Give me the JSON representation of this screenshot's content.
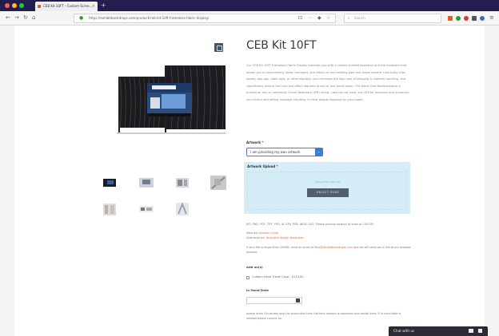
{
  "browser": {
    "tab_title": "CEB Kit 10FT - Custom Scree...",
    "tab_close": "×",
    "new_tab": "+",
    "url": "https://exhibitbackdrops.com/product/ceb-kit-10ft-frameless-fabric-display/",
    "search_placeholder": "Search"
  },
  "product": {
    "title": "CEB Kit 10FT",
    "description": "Our CEB Kit 10FT Frameless Fabric Display provides you with a custom printed backdrop and the hardware that allows you to conveniently store, transport, and attach to any existing pipe and drape system. Less bulky than easels, pop-ups, table tops, or other displays, you eliminate the high cost of shipping & material handling, and significantly reduce the time and effort required to set up and break down. The fabric that Backpackdrop is printed on has an Inherently Flame Retardant (IFR) rating. Last but not least, our CEB kit improves and enhances your brand and selling message resulting in more people stopping by your booth."
  },
  "form": {
    "artwork_label": "Artwork",
    "required_mark": "*",
    "artwork_option": "I am providing my own artwork",
    "upload_label": "Artwork Upload",
    "drop_text": "Drop files here or",
    "select_files": "SELECT FILES",
    "formats_note": "JPG, PNG, PDF, TIFF, PSD, AI, EPS, PSB, INDD, SVG. Please provide artwork to scale at 150 DPI.",
    "view_label": "View our",
    "artwork_guide": "Artwork Guide",
    "download_label": "Download our",
    "templates": "Illustrator design templates",
    "large_file_note": "If your file is larger than 100MB, send an email to",
    "email": "files@exhibitbackdrops.com",
    "large_file_note_2": "and we will send you a link to our dropbox account.",
    "addons_label": "Add on(s)",
    "addon_option": "Custom Hand Travel Case - $173.00",
    "in_hand_label": "In Hand Date",
    "in_hand_note": "please allow 3 business days for production from the time artwork is approved plus transit time. If in-hand date is needed please contact us."
  },
  "chat": {
    "label": "Chat with us"
  },
  "colors": {
    "accent": "#e2693a",
    "select_blue": "#3d7bd8",
    "upload_bg": "#d4edf7",
    "button_dark": "#4f5f6f"
  }
}
